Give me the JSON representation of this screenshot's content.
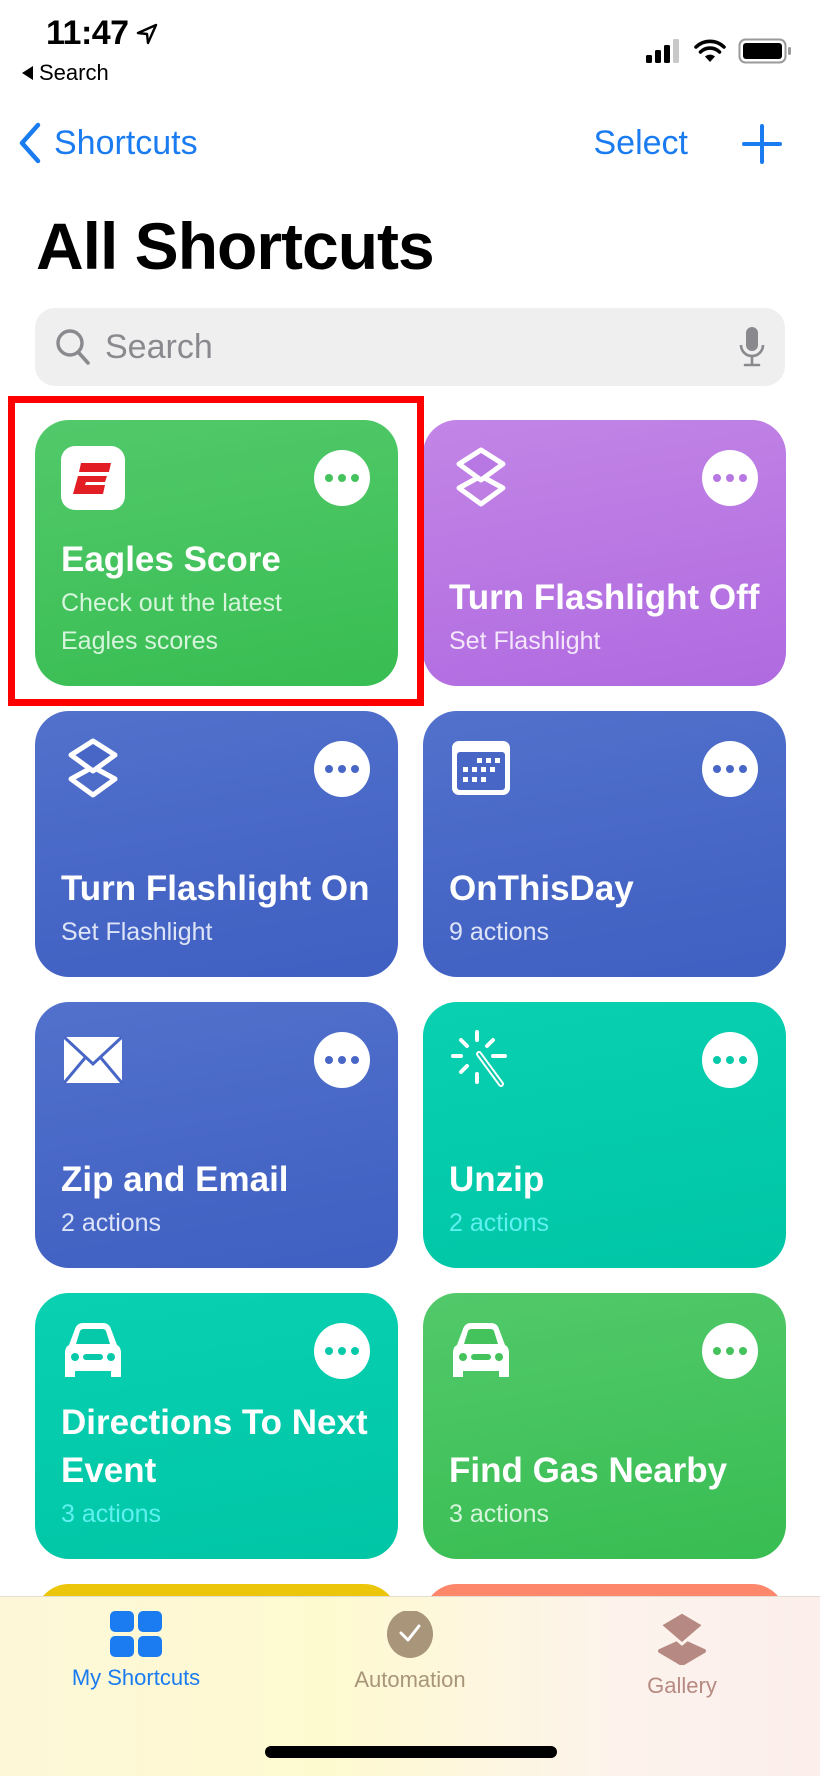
{
  "status_bar": {
    "time": "11:47",
    "back_app_label": "Search"
  },
  "nav": {
    "back_label": "Shortcuts",
    "select_label": "Select",
    "add_icon": "plus-icon"
  },
  "page_title": "All Shortcuts",
  "search": {
    "placeholder": "Search",
    "value": ""
  },
  "colors": {
    "accent": "#1a7cf0",
    "highlight": "#ff0000"
  },
  "shortcuts": [
    {
      "title": "Eagles Score",
      "subtitle": "Check out the latest Eagles scores",
      "icon": "espn-logo-icon",
      "color_top": "#52c96a",
      "color_bottom": "#38bd52",
      "dot_color": "#44c25c",
      "sub_color": "#d6f5dc"
    },
    {
      "title": "Turn Flashlight Off",
      "subtitle": "Set Flashlight",
      "icon": "layers-icon",
      "color_top": "#c285e6",
      "color_bottom": "#b06ae0",
      "dot_color": "#b878e3",
      "sub_color": "#f4e6fb"
    },
    {
      "title": "Turn Flashlight On",
      "subtitle": "Set Flashlight",
      "icon": "layers-icon",
      "color_top": "#5271cc",
      "color_bottom": "#3f5fc2",
      "dot_color": "#4866c6",
      "sub_color": "#dde4f7"
    },
    {
      "title": "OnThisDay",
      "subtitle": "9 actions",
      "icon": "calendar-icon",
      "color_top": "#5271cc",
      "color_bottom": "#3f5fc2",
      "dot_color": "#4866c6",
      "sub_color": "#dde4f7"
    },
    {
      "title": "Zip and Email",
      "subtitle": "2 actions",
      "icon": "envelope-icon",
      "color_top": "#5271cc",
      "color_bottom": "#3f5fc2",
      "dot_color": "#4866c6",
      "sub_color": "#dde4f7"
    },
    {
      "title": "Unzip",
      "subtitle": "2 actions",
      "icon": "magic-wand-icon",
      "color_top": "#08d0b0",
      "color_bottom": "#00c6a6",
      "dot_color": "#06c9aa",
      "sub_color": "#5ff0f0"
    },
    {
      "title": "Directions To Next Event",
      "subtitle": "3 actions",
      "icon": "car-icon",
      "color_top": "#08d0b0",
      "color_bottom": "#00c6a6",
      "dot_color": "#06c9aa",
      "sub_color": "#5ff0f0"
    },
    {
      "title": "Find Gas Nearby",
      "subtitle": "3 actions",
      "icon": "car-icon",
      "color_top": "#52c96a",
      "color_bottom": "#38bd52",
      "dot_color": "#44c25c",
      "sub_color": "#d6f5dc"
    }
  ],
  "partial_cards": [
    {
      "color": "#ecc60a"
    },
    {
      "color": "#fc876b"
    }
  ],
  "tabs": [
    {
      "label": "My Shortcuts",
      "icon": "grid-icon",
      "active": true,
      "color": "#1a7cf0"
    },
    {
      "label": "Automation",
      "icon": "clock-check-icon",
      "active": false,
      "color": "#a8957a"
    },
    {
      "label": "Gallery",
      "icon": "layers-icon",
      "active": false,
      "color": "#b68a82"
    }
  ]
}
